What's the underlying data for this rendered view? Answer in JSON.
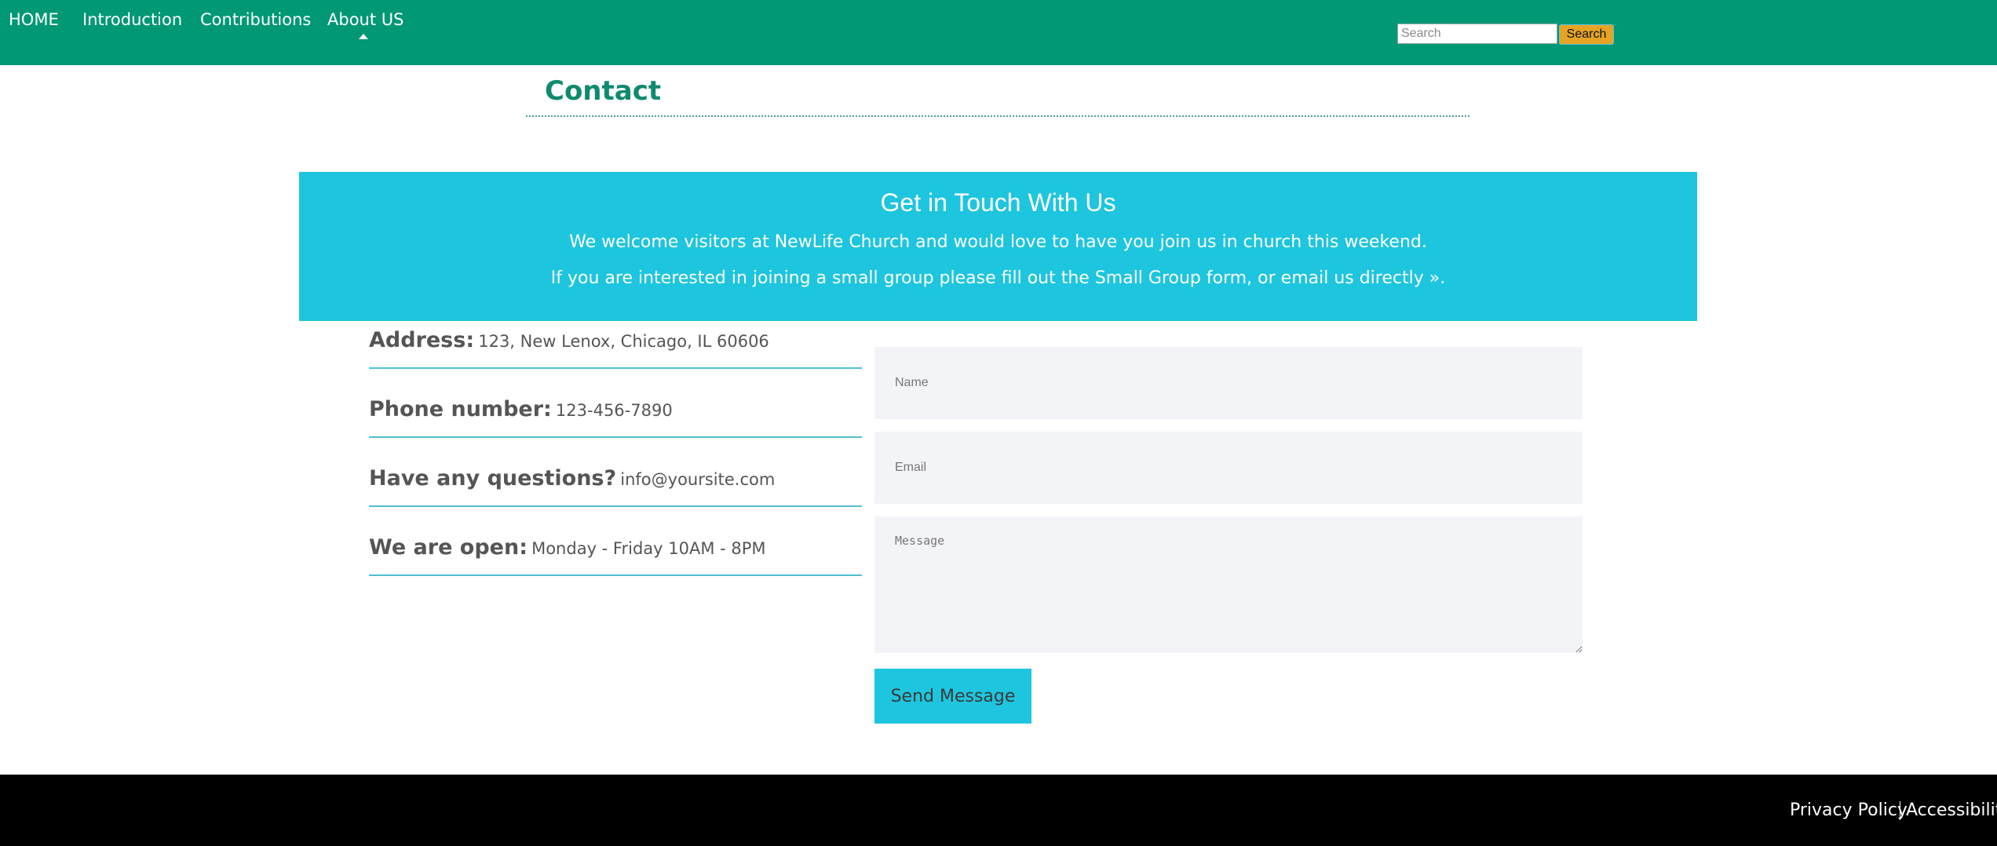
{
  "nav": {
    "items": [
      {
        "label": "HOME"
      },
      {
        "label": "Introduction"
      },
      {
        "label": "Contributions"
      },
      {
        "label": "About US",
        "active": true
      }
    ],
    "search": {
      "placeholder": "Search",
      "button_label": "Search"
    }
  },
  "page": {
    "title": "Contact"
  },
  "banner": {
    "heading": "Get in Touch With Us",
    "line1": "We welcome visitors at NewLife Church and would love to have you join us in church this weekend.",
    "line2": "If you are interested in joining a small group please fill out the Small Group form, or email us directly »."
  },
  "contact_info": [
    {
      "label": "Address:",
      "value": "123, New Lenox, Chicago, IL 60606"
    },
    {
      "label": "Phone number:",
      "value": "123-456-7890"
    },
    {
      "label": "Have any questions?",
      "value": "info@yoursite.com"
    },
    {
      "label": "We are open:",
      "value": "Monday - Friday 10AM - 8PM"
    }
  ],
  "form": {
    "name_placeholder": "Name",
    "email_placeholder": "Email",
    "message_placeholder": "Message",
    "submit_label": "Send Message"
  },
  "footer": {
    "links": [
      {
        "label": "Privacy Policy"
      },
      {
        "label": "Accessibility"
      }
    ]
  },
  "colors": {
    "nav_background": "#009875",
    "banner_background": "#1ec5de",
    "title_color": "#0f8a6f",
    "search_button": "#e5a424",
    "footer_background": "#000000"
  }
}
